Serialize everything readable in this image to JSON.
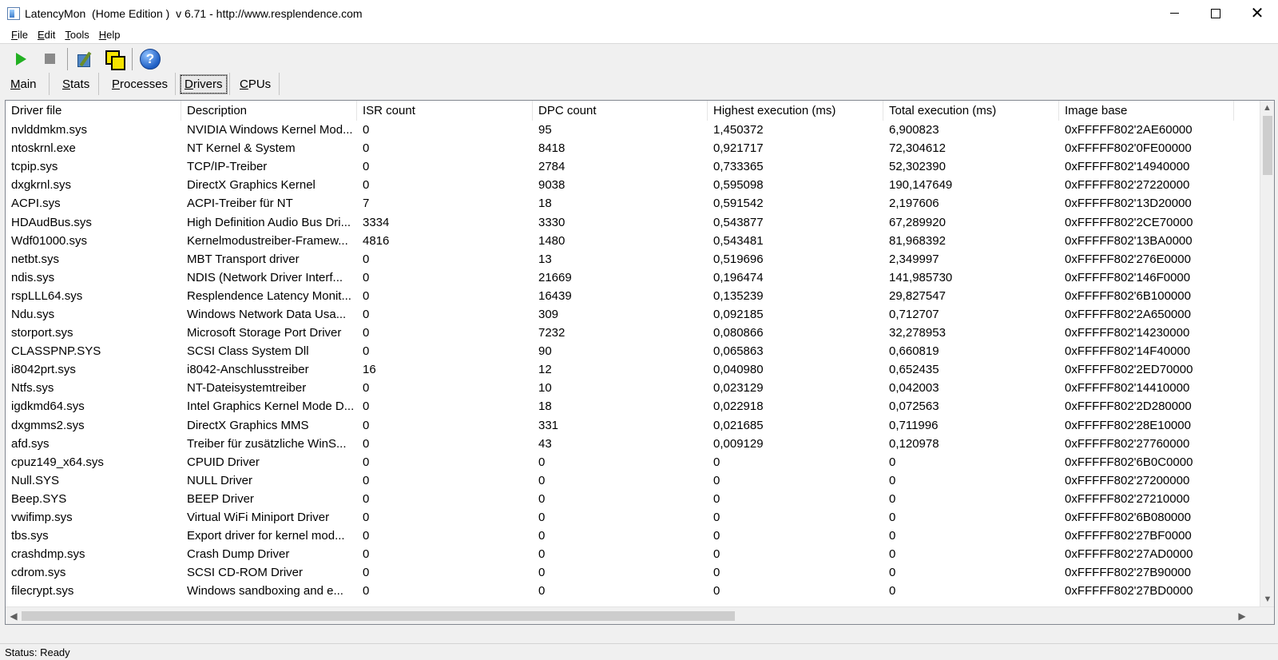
{
  "window": {
    "title": "LatencyMon  (Home Edition )  v 6.71 - http://www.resplendence.com",
    "close_glyph": "✕"
  },
  "menu": [
    {
      "first": "F",
      "rest": "ile"
    },
    {
      "first": "E",
      "rest": "dit"
    },
    {
      "first": "T",
      "rest": "ools"
    },
    {
      "first": "H",
      "rest": "elp"
    }
  ],
  "toolbar": {
    "icons": [
      "play-icon",
      "stop-icon",
      "tools-icon",
      "windows-icon",
      "help-icon"
    ],
    "help_glyph": "?"
  },
  "tabs": [
    {
      "first": "M",
      "rest": "ain"
    },
    {
      "first": "S",
      "rest": "tats"
    },
    {
      "first": "P",
      "rest": "rocesses"
    },
    {
      "first": "D",
      "rest": "rivers"
    },
    {
      "first": "C",
      "rest": "PUs"
    }
  ],
  "active_tab": "Drivers",
  "table": {
    "columns": [
      "Driver file",
      "Description",
      "ISR count",
      "DPC count",
      "Highest execution (ms)",
      "Total execution (ms)",
      "Image base"
    ],
    "rows": [
      [
        "nvlddmkm.sys",
        "NVIDIA Windows Kernel Mod...",
        "0",
        "95",
        "1,450372",
        "6,900823",
        "0xFFFFF802'2AE60000"
      ],
      [
        "ntoskrnl.exe",
        "NT Kernel & System",
        "0",
        "8418",
        "0,921717",
        "72,304612",
        "0xFFFFF802'0FE00000"
      ],
      [
        "tcpip.sys",
        "TCP/IP-Treiber",
        "0",
        "2784",
        "0,733365",
        "52,302390",
        "0xFFFFF802'14940000"
      ],
      [
        "dxgkrnl.sys",
        "DirectX Graphics Kernel",
        "0",
        "9038",
        "0,595098",
        "190,147649",
        "0xFFFFF802'27220000"
      ],
      [
        "ACPI.sys",
        "ACPI-Treiber für NT",
        "7",
        "18",
        "0,591542",
        "2,197606",
        "0xFFFFF802'13D20000"
      ],
      [
        "HDAudBus.sys",
        "High Definition Audio Bus Dri...",
        "3334",
        "3330",
        "0,543877",
        "67,289920",
        "0xFFFFF802'2CE70000"
      ],
      [
        "Wdf01000.sys",
        "Kernelmodustreiber-Framew...",
        "4816",
        "1480",
        "0,543481",
        "81,968392",
        "0xFFFFF802'13BA0000"
      ],
      [
        "netbt.sys",
        "MBT Transport driver",
        "0",
        "13",
        "0,519696",
        "2,349997",
        "0xFFFFF802'276E0000"
      ],
      [
        "ndis.sys",
        "NDIS (Network Driver Interf...",
        "0",
        "21669",
        "0,196474",
        "141,985730",
        "0xFFFFF802'146F0000"
      ],
      [
        "rspLLL64.sys",
        "Resplendence Latency Monit...",
        "0",
        "16439",
        "0,135239",
        "29,827547",
        "0xFFFFF802'6B100000"
      ],
      [
        "Ndu.sys",
        "Windows Network Data Usa...",
        "0",
        "309",
        "0,092185",
        "0,712707",
        "0xFFFFF802'2A650000"
      ],
      [
        "storport.sys",
        "Microsoft Storage Port Driver",
        "0",
        "7232",
        "0,080866",
        "32,278953",
        "0xFFFFF802'14230000"
      ],
      [
        "CLASSPNP.SYS",
        "SCSI Class System Dll",
        "0",
        "90",
        "0,065863",
        "0,660819",
        "0xFFFFF802'14F40000"
      ],
      [
        "i8042prt.sys",
        "i8042-Anschlusstreiber",
        "16",
        "12",
        "0,040980",
        "0,652435",
        "0xFFFFF802'2ED70000"
      ],
      [
        "Ntfs.sys",
        "NT-Dateisystemtreiber",
        "0",
        "10",
        "0,023129",
        "0,042003",
        "0xFFFFF802'14410000"
      ],
      [
        "igdkmd64.sys",
        "Intel Graphics Kernel Mode D...",
        "0",
        "18",
        "0,022918",
        "0,072563",
        "0xFFFFF802'2D280000"
      ],
      [
        "dxgmms2.sys",
        "DirectX Graphics MMS",
        "0",
        "331",
        "0,021685",
        "0,711996",
        "0xFFFFF802'28E10000"
      ],
      [
        "afd.sys",
        "Treiber für zusätzliche WinS...",
        "0",
        "43",
        "0,009129",
        "0,120978",
        "0xFFFFF802'27760000"
      ],
      [
        "cpuz149_x64.sys",
        "CPUID Driver",
        "0",
        "0",
        "0",
        "0",
        "0xFFFFF802'6B0C0000"
      ],
      [
        "Null.SYS",
        "NULL Driver",
        "0",
        "0",
        "0",
        "0",
        "0xFFFFF802'27200000"
      ],
      [
        "Beep.SYS",
        "BEEP Driver",
        "0",
        "0",
        "0",
        "0",
        "0xFFFFF802'27210000"
      ],
      [
        "vwifimp.sys",
        "Virtual WiFi Miniport Driver",
        "0",
        "0",
        "0",
        "0",
        "0xFFFFF802'6B080000"
      ],
      [
        "tbs.sys",
        "Export driver for kernel mod...",
        "0",
        "0",
        "0",
        "0",
        "0xFFFFF802'27BF0000"
      ],
      [
        "crashdmp.sys",
        "Crash Dump Driver",
        "0",
        "0",
        "0",
        "0",
        "0xFFFFF802'27AD0000"
      ],
      [
        "cdrom.sys",
        "SCSI CD-ROM Driver",
        "0",
        "0",
        "0",
        "0",
        "0xFFFFF802'27B90000"
      ],
      [
        "filecrypt.sys",
        "Windows sandboxing and e...",
        "0",
        "0",
        "0",
        "0",
        "0xFFFFF802'27BD0000"
      ]
    ]
  },
  "scrollbars": {
    "up": "▲",
    "down": "▼",
    "left": "◀",
    "right": "▶"
  },
  "status": "Status: Ready"
}
